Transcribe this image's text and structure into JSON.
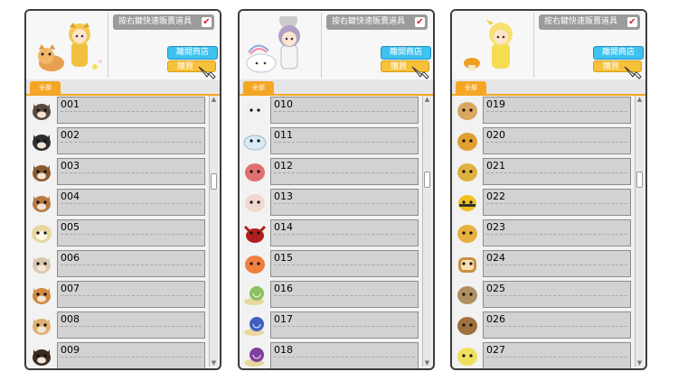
{
  "panels": [
    {
      "auto_sell_label": "按右鍵快速販賣道具",
      "auto_sell_checked": "✔",
      "leave_label": "離開商店",
      "buy_label": "購買",
      "tab_label": "全部",
      "items": [
        {
          "id": "001",
          "icon": "cat-face-icon",
          "color": "#5a4a3e"
        },
        {
          "id": "002",
          "icon": "cat-face-icon",
          "color": "#2e2e2e"
        },
        {
          "id": "003",
          "icon": "dog-face-icon",
          "color": "#8a5a2e"
        },
        {
          "id": "004",
          "icon": "dog-face-icon",
          "color": "#b87a44"
        },
        {
          "id": "005",
          "icon": "sheep-face-icon",
          "color": "#e8d8a0"
        },
        {
          "id": "006",
          "icon": "dog-face-icon",
          "color": "#d8c8b0"
        },
        {
          "id": "007",
          "icon": "shiba-face-icon",
          "color": "#d08a40"
        },
        {
          "id": "008",
          "icon": "dog-face-icon",
          "color": "#e0b070"
        },
        {
          "id": "009",
          "icon": "dog-face-icon",
          "color": "#3a2a20"
        }
      ]
    },
    {
      "auto_sell_label": "按右鍵快速販賣道具",
      "auto_sell_checked": "✔",
      "leave_label": "離開商店",
      "buy_label": "購買",
      "tab_label": "全部",
      "items": [
        {
          "id": "010",
          "icon": "white-blob-icon",
          "color": "#f0f0f0"
        },
        {
          "id": "011",
          "icon": "cloud-icon",
          "color": "#d8eaf5"
        },
        {
          "id": "012",
          "icon": "pink-bunny-icon",
          "color": "#e07070"
        },
        {
          "id": "013",
          "icon": "bunny-face-icon",
          "color": "#f0d8d0"
        },
        {
          "id": "014",
          "icon": "red-crab-icon",
          "color": "#b02020"
        },
        {
          "id": "015",
          "icon": "sushi-icon",
          "color": "#f08040"
        },
        {
          "id": "016",
          "icon": "snail-icon",
          "color": "#8cc060"
        },
        {
          "id": "017",
          "icon": "snail-icon",
          "color": "#4060c0"
        },
        {
          "id": "018",
          "icon": "snail-icon",
          "color": "#8040a0"
        }
      ]
    },
    {
      "auto_sell_label": "按右鍵快速販賣道具",
      "auto_sell_checked": "✔",
      "leave_label": "離開商店",
      "buy_label": "購買",
      "tab_label": "全部",
      "items": [
        {
          "id": "019",
          "icon": "hamster-icon",
          "color": "#d8a860"
        },
        {
          "id": "020",
          "icon": "duck-icon",
          "color": "#e0a030"
        },
        {
          "id": "021",
          "icon": "chick-icon",
          "color": "#e0b040"
        },
        {
          "id": "022",
          "icon": "bee-icon",
          "color": "#f0c020"
        },
        {
          "id": "023",
          "icon": "mushroom-icon",
          "color": "#e8b040"
        },
        {
          "id": "024",
          "icon": "bread-icon",
          "color": "#c89040"
        },
        {
          "id": "025",
          "icon": "monkey-icon",
          "color": "#b09060"
        },
        {
          "id": "026",
          "icon": "sparrow-icon",
          "color": "#a07040"
        },
        {
          "id": "027",
          "icon": "chick-icon",
          "color": "#f0e060"
        }
      ]
    }
  ]
}
